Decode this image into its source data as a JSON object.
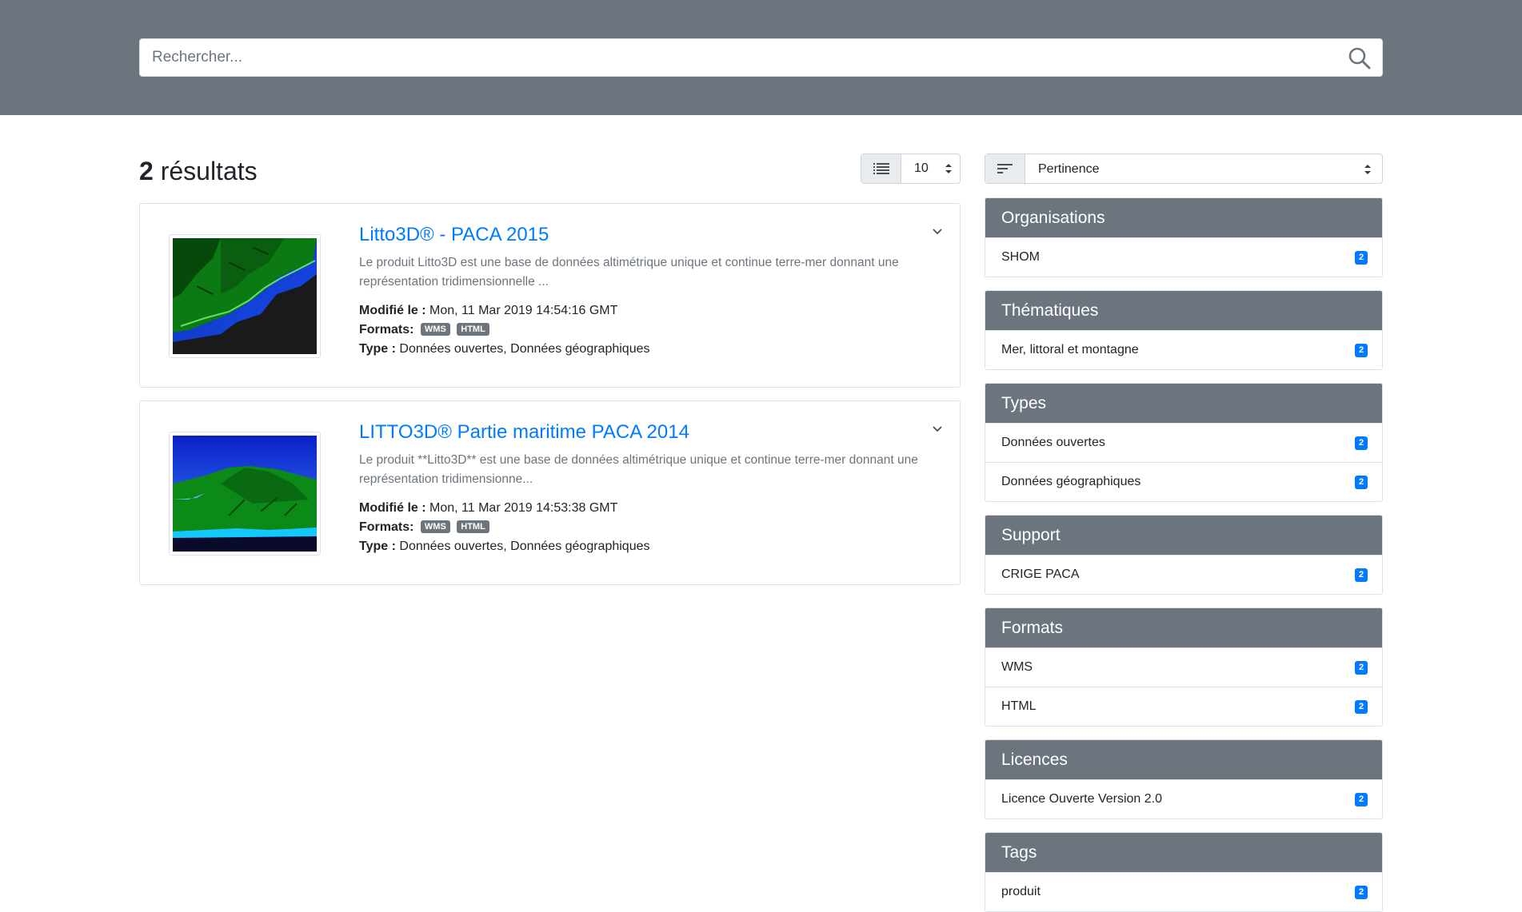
{
  "search": {
    "placeholder": "Rechercher..."
  },
  "results": {
    "count": "2",
    "label": "résultats",
    "per_page": "10",
    "sort": "Pertinence"
  },
  "datasets": [
    {
      "title": "Litto3D® - PACA 2015",
      "description": "Le produit Litto3D est une base de données altimétrique unique et continue terre-mer donnant une représentation tridimensionnelle ...",
      "modified_label": "Modifié le :",
      "modified": "Mon, 11 Mar 2019 14:54:16 GMT",
      "formats_label": "Formats:",
      "formats": [
        "WMS",
        "HTML"
      ],
      "type_label": "Type :",
      "type": "Données ouvertes, Données géographiques"
    },
    {
      "title": "LITTO3D® Partie maritime PACA 2014",
      "description": "Le produit **Litto3D** est une base de données altimétrique unique et continue terre-mer donnant une représentation tridimensionne...",
      "modified_label": "Modifié le :",
      "modified": "Mon, 11 Mar 2019 14:53:38 GMT",
      "formats_label": "Formats:",
      "formats": [
        "WMS",
        "HTML"
      ],
      "type_label": "Type :",
      "type": "Données ouvertes, Données géographiques"
    }
  ],
  "facets": [
    {
      "title": "Organisations",
      "items": [
        {
          "label": "SHOM",
          "count": "2"
        }
      ]
    },
    {
      "title": "Thématiques",
      "items": [
        {
          "label": "Mer, littoral et montagne",
          "count": "2"
        }
      ]
    },
    {
      "title": "Types",
      "items": [
        {
          "label": "Données ouvertes",
          "count": "2"
        },
        {
          "label": "Données géographiques",
          "count": "2"
        }
      ]
    },
    {
      "title": "Support",
      "items": [
        {
          "label": "CRIGE PACA",
          "count": "2"
        }
      ]
    },
    {
      "title": "Formats",
      "items": [
        {
          "label": "WMS",
          "count": "2"
        },
        {
          "label": "HTML",
          "count": "2"
        }
      ]
    },
    {
      "title": "Licences",
      "items": [
        {
          "label": "Licence Ouverte Version 2.0",
          "count": "2"
        }
      ]
    },
    {
      "title": "Tags",
      "items": [
        {
          "label": "produit",
          "count": "2"
        }
      ]
    }
  ],
  "icons": {
    "search": "search-icon",
    "list": "list-icon",
    "sort": "sort-icon",
    "chevron": "chevron-down-icon"
  },
  "colors": {
    "header": "#6c757d",
    "link": "#007bff",
    "badge": "#6c757d",
    "count_badge": "#007bff"
  }
}
